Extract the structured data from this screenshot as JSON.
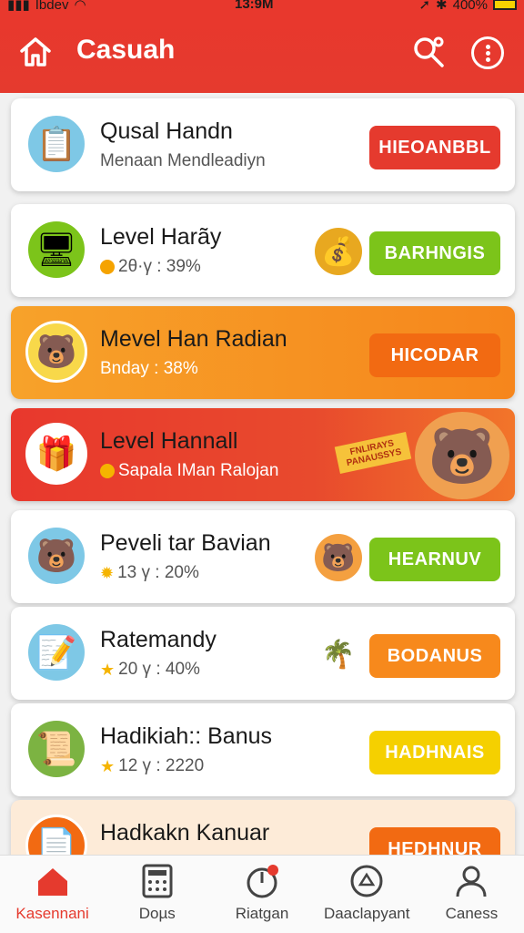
{
  "status_bar": {
    "carrier": "Ibdev",
    "time": "13:9M",
    "battery": "400%"
  },
  "header": {
    "title": "Casuah"
  },
  "cards": [
    {
      "name": "Qusal Handn",
      "sub": "Menaan Mendleadiyn",
      "button": "HIEOANBBL"
    },
    {
      "name": "Level Harãy",
      "sub": "2θ·γ : 39%",
      "button": "BARHNGIS"
    },
    {
      "name": "Mevel Han Radian",
      "sub": "Bnday : 38%",
      "button": "HICODAR"
    },
    {
      "name": "Level Hannall",
      "sub": "Sapala IMan Ralojan",
      "banner": "FNLIRAYS PANAUSSYS"
    },
    {
      "name": "Peveli tar Bavian",
      "sub": "13 γ : 20%",
      "button": "HEARNUV"
    },
    {
      "name": "Ratemandy",
      "sub": "20 γ : 40%",
      "button": "BODANUS"
    },
    {
      "name": "Hadikiah:: Banus",
      "sub": "12 γ : 2220",
      "button": "HADHNAIS"
    },
    {
      "name": "Hadkakn Kanuar",
      "sub": "",
      "button": "HEDHNUR"
    }
  ],
  "colors": {
    "red": "#e53a2e",
    "green": "#7cc41a",
    "orange": "#f7891c",
    "yellow": "#f5d000",
    "orange_card": "#f89a2a"
  },
  "bottom_nav": [
    {
      "label": "Kasennani",
      "icon": "home-icon"
    },
    {
      "label": "Doµs",
      "icon": "calculator-icon"
    },
    {
      "label": "Riatgan",
      "icon": "timer-icon"
    },
    {
      "label": "Daaclapyant",
      "icon": "recycle-icon"
    },
    {
      "label": "Caness",
      "icon": "user-icon"
    }
  ]
}
